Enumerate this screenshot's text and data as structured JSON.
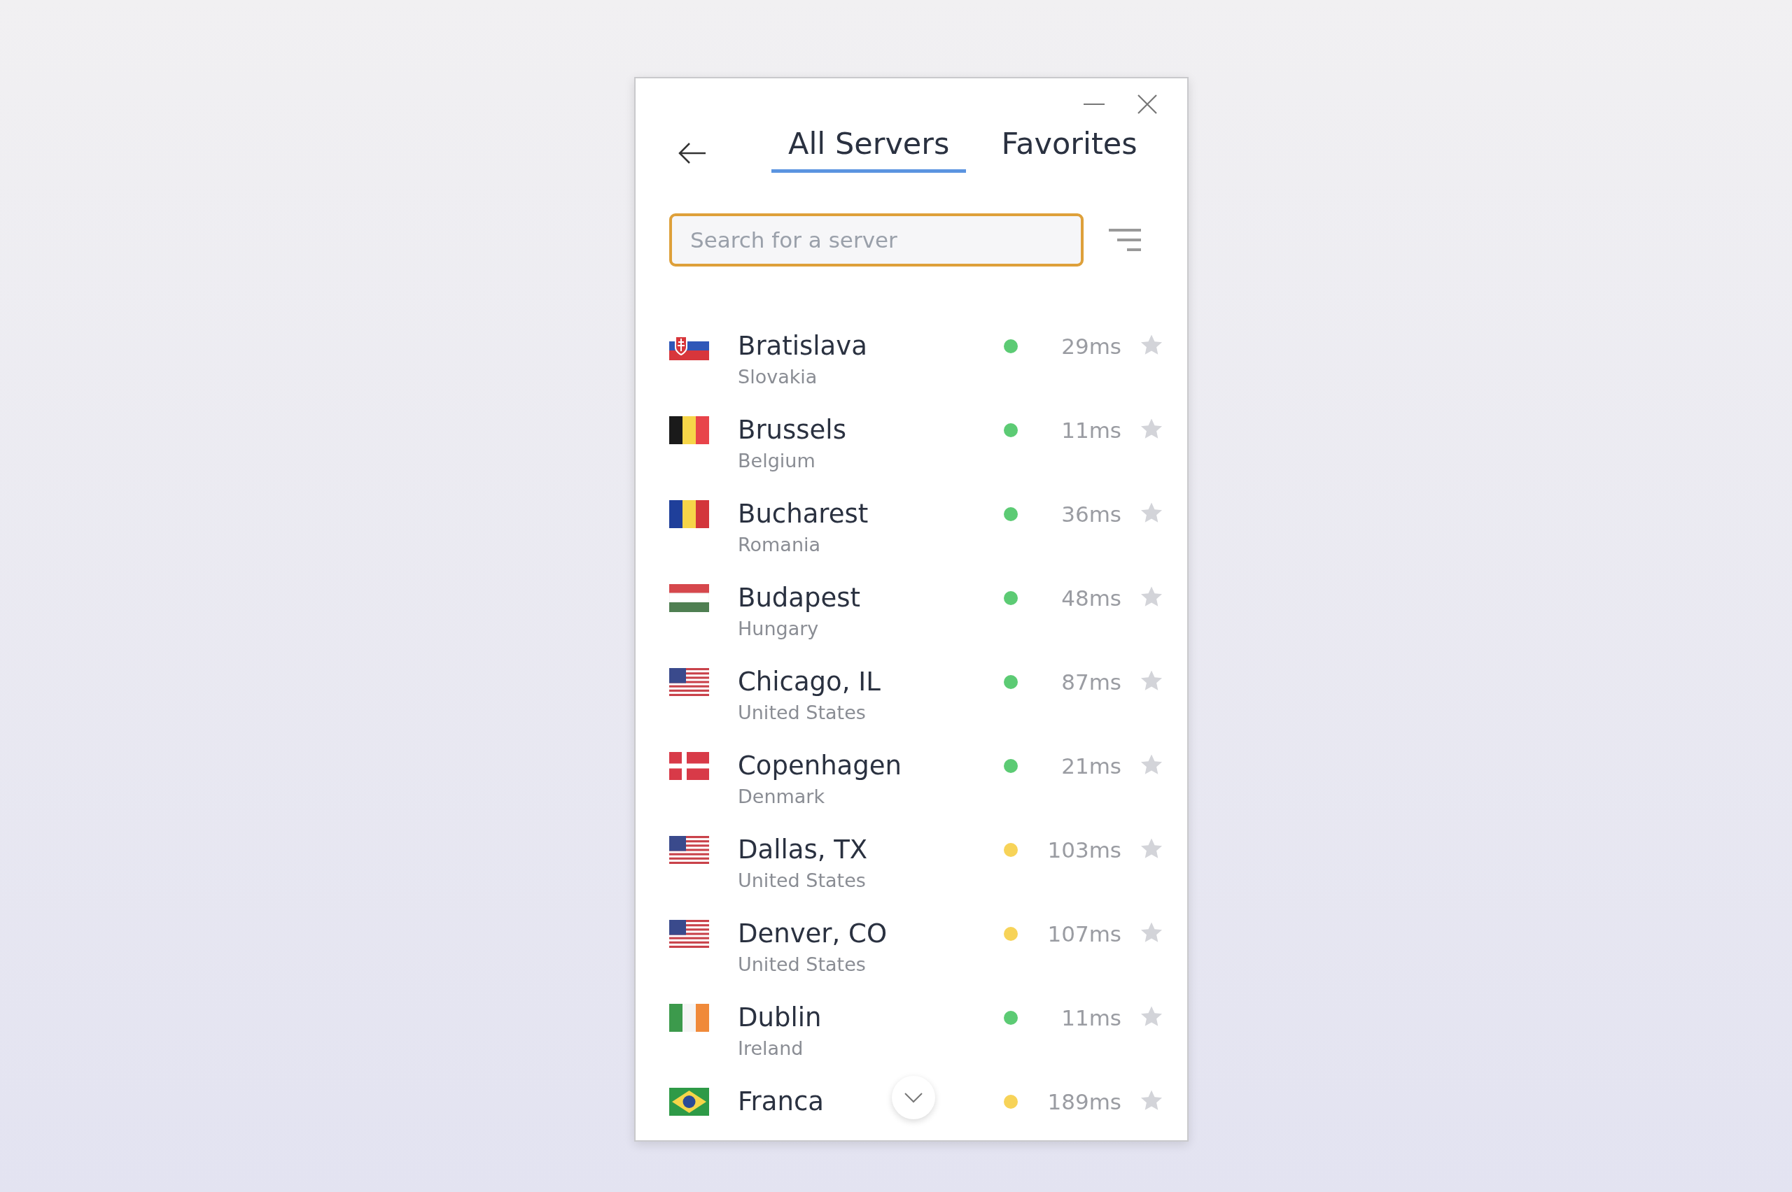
{
  "tabs": [
    {
      "label": "All Servers",
      "selected": true
    },
    {
      "label": "Favorites",
      "selected": false
    }
  ],
  "search": {
    "placeholder": "Search for a server"
  },
  "servers": [
    {
      "city": "Bratislava",
      "country": "Slovakia",
      "kind": "sk",
      "color": "#5ccb74",
      "latency": "29ms",
      "favorite": false
    },
    {
      "city": "Brussels",
      "country": "Belgium",
      "kind": "be",
      "color": "#5ccb74",
      "latency": "11ms",
      "favorite": false
    },
    {
      "city": "Bucharest",
      "country": "Romania",
      "kind": "ro",
      "color": "#5ccb74",
      "latency": "36ms",
      "favorite": false
    },
    {
      "city": "Budapest",
      "country": "Hungary",
      "kind": "hu",
      "color": "#5ccb74",
      "latency": "48ms",
      "favorite": false
    },
    {
      "city": "Chicago, IL",
      "country": "United States",
      "kind": "us",
      "color": "#5ccb74",
      "latency": "87ms",
      "favorite": false
    },
    {
      "city": "Copenhagen",
      "country": "Denmark",
      "kind": "dk",
      "color": "#5ccb74",
      "latency": "21ms",
      "favorite": false
    },
    {
      "city": "Dallas, TX",
      "country": "United States",
      "kind": "us",
      "color": "#f7d358",
      "latency": "103ms",
      "favorite": false
    },
    {
      "city": "Denver, CO",
      "country": "United States",
      "kind": "us",
      "color": "#f7d358",
      "latency": "107ms",
      "favorite": false
    },
    {
      "city": "Dublin",
      "country": "Ireland",
      "kind": "ie",
      "color": "#5ccb74",
      "latency": "11ms",
      "favorite": false
    },
    {
      "city": "Franca",
      "kind": "br",
      "color": "#f7d358",
      "latency": "189ms",
      "favorite": false
    }
  ]
}
